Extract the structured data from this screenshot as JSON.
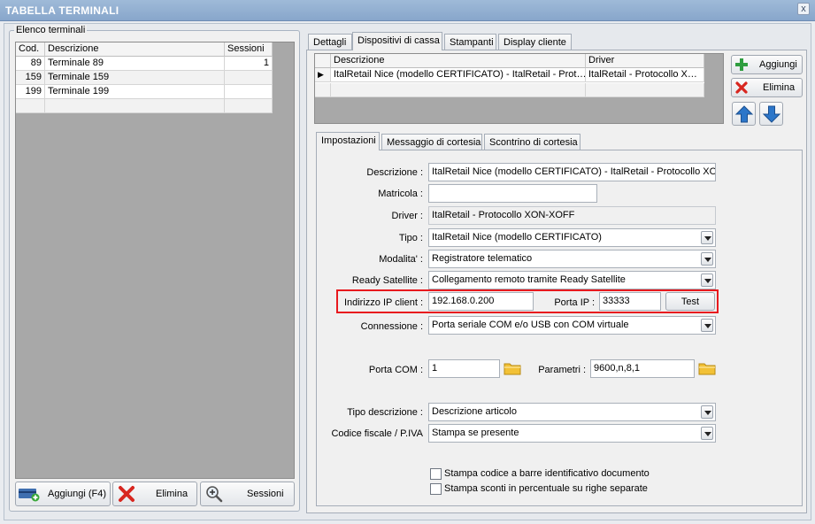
{
  "window": {
    "title": "TABELLA TERMINALI",
    "close": "x"
  },
  "left": {
    "group_label": "Elenco terminali",
    "columns": [
      "Cod.",
      "Descrizione",
      "Sessioni"
    ],
    "rows": [
      {
        "cod": "89",
        "desc": "Terminale 89",
        "sess": "1"
      },
      {
        "cod": "159",
        "desc": "Terminale 159",
        "sess": ""
      },
      {
        "cod": "199",
        "desc": "Terminale 199",
        "sess": ""
      }
    ],
    "buttons": {
      "add": "Aggiungi (F4)",
      "delete": "Elimina",
      "sessions": "Sessioni"
    }
  },
  "top_tabs": [
    "Dettagli",
    "Dispositivi di cassa",
    "Stampanti",
    "Display cliente"
  ],
  "devices": {
    "columns": [
      "Descrizione",
      "Driver"
    ],
    "rows": [
      {
        "marker": "▶",
        "desc": "ItalRetail Nice (modello CERTIFICATO) - ItalRetail - Prot…",
        "driver": "ItalRetail - Protocollo X…"
      }
    ],
    "add": "Aggiungi",
    "delete": "Elimina"
  },
  "sub_tabs": [
    "Impostazioni",
    "Messaggio di cortesia",
    "Scontrino di cortesia"
  ],
  "form": {
    "descrizione_label": "Descrizione :",
    "descrizione": "ItalRetail Nice (modello CERTIFICATO) - ItalRetail - Protocollo XON",
    "matricola_label": "Matricola :",
    "matricola": "",
    "driver_label": "Driver :",
    "driver": "ItalRetail - Protocollo XON-XOFF",
    "tipo_label": "Tipo :",
    "tipo": "ItalRetail Nice (modello CERTIFICATO)",
    "modalita_label": "Modalita' :",
    "modalita": "Registratore telematico",
    "ready_label": "Ready Satellite :",
    "ready": "Collegamento remoto tramite Ready Satellite",
    "ip_label": "Indirizzo IP client :",
    "ip": "192.168.0.200",
    "porta_ip_label": "Porta IP :",
    "porta_ip": "33333",
    "test": "Test",
    "connessione_label": "Connessione :",
    "connessione": "Porta seriale COM e/o USB con COM virtuale",
    "porta_com_label": "Porta COM :",
    "porta_com": "1",
    "parametri_label": "Parametri :",
    "parametri": "9600,n,8,1",
    "tipo_desc_label": "Tipo descrizione :",
    "tipo_desc": "Descrizione articolo",
    "cf_label": "Codice fiscale / P.IVA",
    "cf": "Stampa se presente",
    "chk1": "Stampa codice a barre identificativo documento",
    "chk2": "Stampa sconti in percentuale su righe separate"
  },
  "colors": {
    "highlight": "#e8191e",
    "title_bar": "#9fbad8"
  }
}
